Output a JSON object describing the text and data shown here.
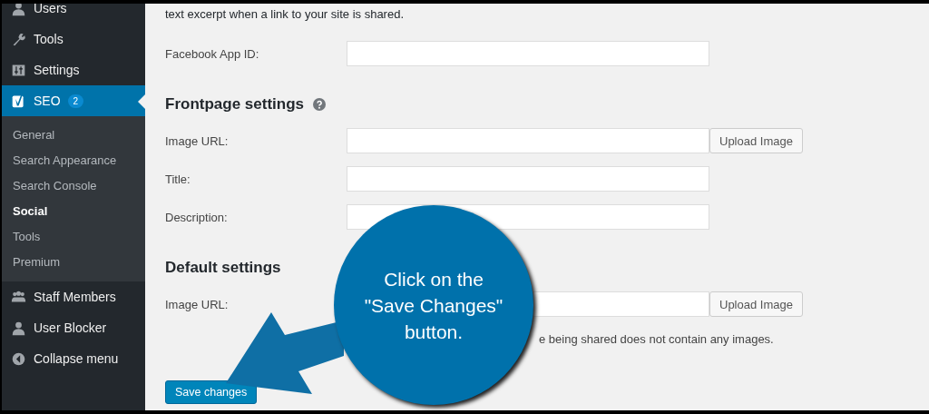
{
  "sidebar": {
    "items": [
      {
        "label": "Users",
        "selected": false
      },
      {
        "label": "Tools",
        "selected": false
      },
      {
        "label": "Settings",
        "selected": false
      },
      {
        "label": "SEO",
        "selected": true,
        "badge": "2",
        "children": [
          {
            "label": "General",
            "selected": false
          },
          {
            "label": "Search Appearance",
            "selected": false
          },
          {
            "label": "Search Console",
            "selected": false
          },
          {
            "label": "Social",
            "selected": true
          },
          {
            "label": "Tools",
            "selected": false
          },
          {
            "label": "Premium",
            "selected": false
          }
        ]
      },
      {
        "label": "Staff Members",
        "selected": false
      },
      {
        "label": "User Blocker",
        "selected": false
      },
      {
        "label": "Collapse menu",
        "selected": false
      }
    ]
  },
  "content": {
    "intro": "text excerpt when a link to your site is shared.",
    "app_id": {
      "label": "Facebook App ID:"
    },
    "sections": [
      {
        "heading": "Frontpage settings",
        "help_icon": true,
        "fields": [
          {
            "label": "Image URL:",
            "button": "Upload Image"
          },
          {
            "label": "Title:"
          },
          {
            "label": "Description:"
          }
        ]
      },
      {
        "heading": "Default settings",
        "help_icon": false,
        "fields": [
          {
            "label": "Image URL:",
            "button": "Upload Image",
            "hint": "e being shared does not contain any images."
          }
        ]
      }
    ],
    "save_button": "Save changes"
  },
  "callout": {
    "text": [
      "Click on the",
      "\"Save Changes\"",
      "button."
    ]
  }
}
